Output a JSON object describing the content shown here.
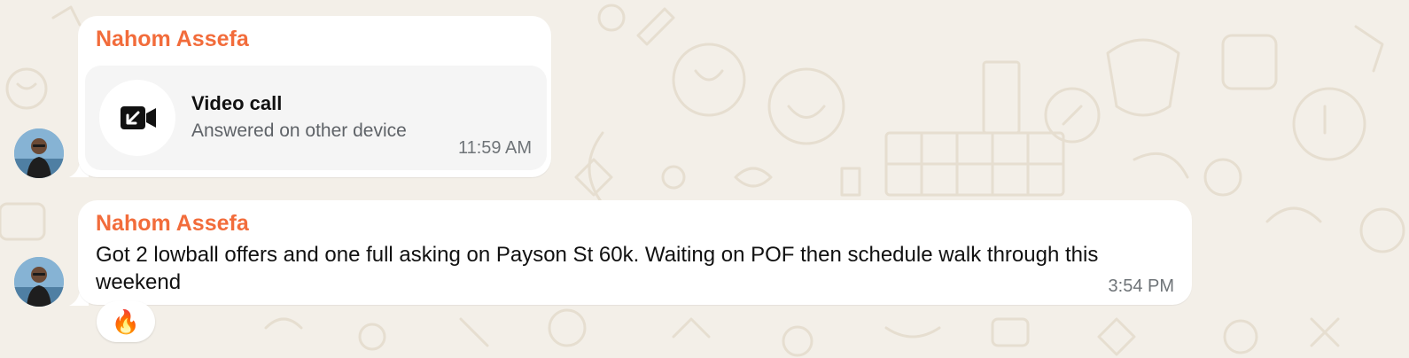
{
  "chat": {
    "messages": [
      {
        "sender": "Nahom Assefa",
        "type": "call",
        "call_title": "Video call",
        "call_status": "Answered on other device",
        "call_icon": "video-camera-incoming-icon",
        "time": "11:59 AM"
      },
      {
        "sender": "Nahom Assefa",
        "type": "text",
        "text": "Got 2 lowball offers and one full asking on Payson St 60k. Waiting on POF then schedule walk through this weekend",
        "time": "3:54 PM",
        "reaction": "🔥"
      }
    ]
  },
  "colors": {
    "background": "#f3efe8",
    "sender_name": "#f26c3b",
    "bubble": "#ffffff",
    "call_card": "#f5f5f5"
  }
}
